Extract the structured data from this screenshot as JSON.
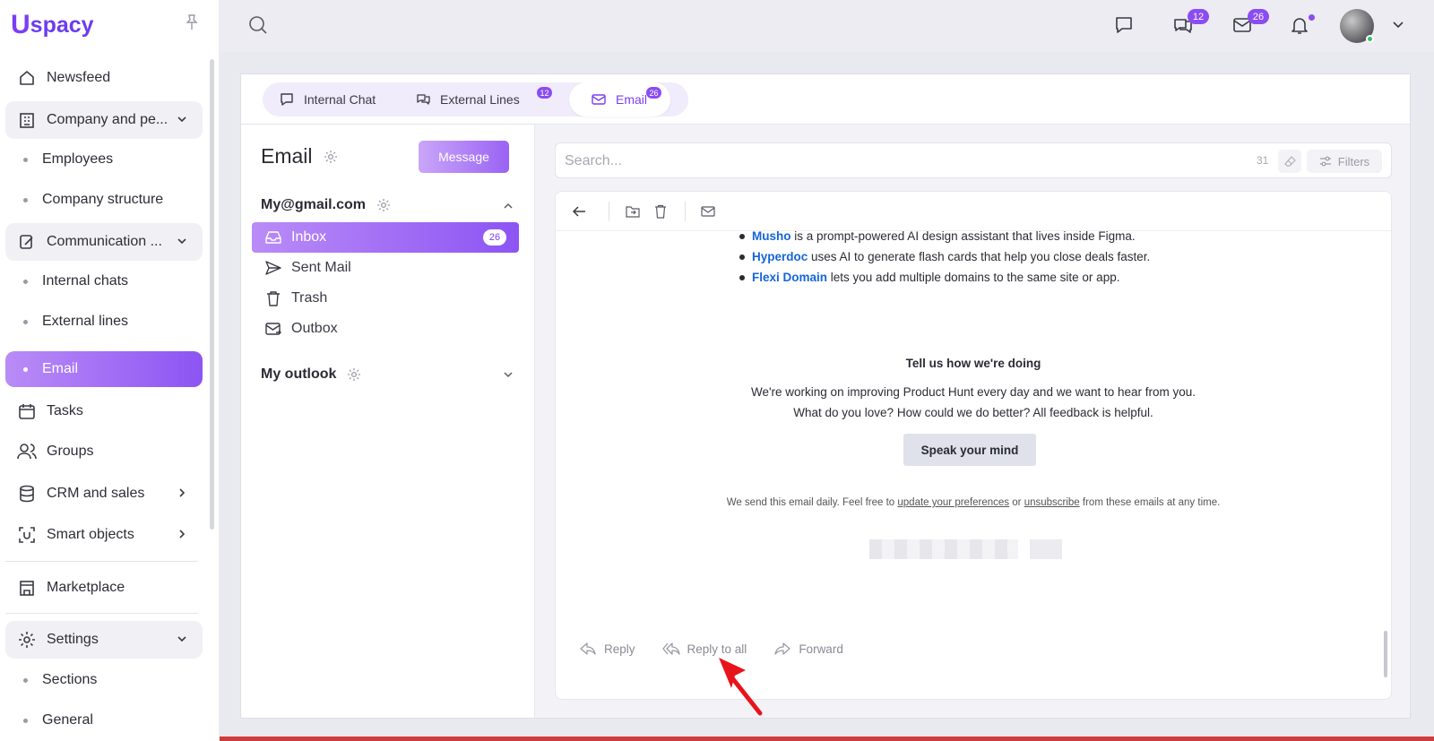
{
  "brand": {
    "logo_mark": "U",
    "logo_text": "spacy",
    "accent": "#7b3ff2"
  },
  "sidebar": {
    "items": [
      {
        "label": "Newsfeed",
        "icon": "home-icon"
      },
      {
        "label": "Company and pe...",
        "icon": "building-icon",
        "expanded": true
      },
      {
        "label": "Employees"
      },
      {
        "label": "Company structure"
      },
      {
        "label": "Communication ...",
        "icon": "communication-icon",
        "expanded": true
      },
      {
        "label": "Internal chats"
      },
      {
        "label": "External lines"
      },
      {
        "label": "Email",
        "active": true
      },
      {
        "label": "Tasks",
        "icon": "calendar-icon"
      },
      {
        "label": "Groups",
        "icon": "users-icon"
      },
      {
        "label": "CRM and sales",
        "icon": "database-icon"
      },
      {
        "label": "Smart objects",
        "icon": "scan-icon"
      },
      {
        "label": "Marketplace",
        "icon": "store-icon"
      },
      {
        "label": "Settings",
        "icon": "gear-icon",
        "expanded": true
      },
      {
        "label": "Sections"
      },
      {
        "label": "General"
      }
    ]
  },
  "topbar": {
    "chat_badge": "12",
    "mail_badge": "26"
  },
  "tabs": [
    {
      "label": "Internal Chat",
      "icon": "chat-icon"
    },
    {
      "label": "External Lines",
      "icon": "chats-icon",
      "badge": "12"
    },
    {
      "label": "Email",
      "icon": "mail-icon",
      "badge": "26",
      "active": true
    }
  ],
  "folders": {
    "title": "Email",
    "message_button": "Message",
    "accounts": [
      {
        "name": "My@gmail.com",
        "expanded": true
      },
      {
        "name": "My outlook",
        "expanded": false
      }
    ],
    "items": [
      {
        "label": "Inbox",
        "count": "26",
        "active": true,
        "icon": "inbox-icon"
      },
      {
        "label": "Sent Mail",
        "icon": "send-icon"
      },
      {
        "label": "Trash",
        "icon": "trash-icon"
      },
      {
        "label": "Outbox",
        "icon": "outbox-icon"
      }
    ]
  },
  "search": {
    "placeholder": "Search...",
    "count": "31",
    "filters_label": "Filters"
  },
  "email": {
    "bullets": [
      {
        "link": "Musho",
        "text": " is a prompt-powered AI design assistant that lives inside Figma."
      },
      {
        "link": "Hyperdoc",
        "text": " uses AI to generate flash cards that help you close deals faster."
      },
      {
        "link": "Flexi Domain",
        "text": " lets you add multiple domains to the same site or app."
      }
    ],
    "feedback_title": "Tell us how we're doing",
    "feedback_line1": "We're working on improving Product Hunt every day and we want to hear from you.",
    "feedback_line2": "What do you love? How could we do better? All feedback is helpful.",
    "speak_button": "Speak your mind",
    "footer_pre": "We send this email daily. Feel free to ",
    "footer_link1": "update your preferences",
    "footer_mid": " or ",
    "footer_link2": "unsubscribe",
    "footer_post": " from these emails at any time.",
    "actions": {
      "reply": "Reply",
      "reply_all": "Reply to all",
      "forward": "Forward"
    }
  }
}
